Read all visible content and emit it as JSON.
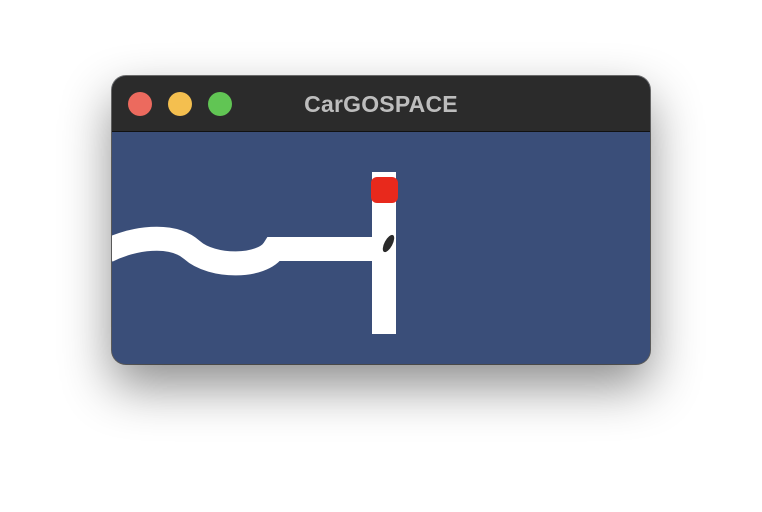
{
  "window": {
    "title": "CarGOSPACE",
    "controls": [
      "close",
      "minimize",
      "zoom"
    ]
  },
  "scene": {
    "background_color": "#3a4e79",
    "road_color": "#ffffff",
    "car_color": "#e8291c",
    "marker_color": "#2a2a2a",
    "icons": [
      "road-track",
      "car-icon",
      "obstacle-marker"
    ]
  }
}
